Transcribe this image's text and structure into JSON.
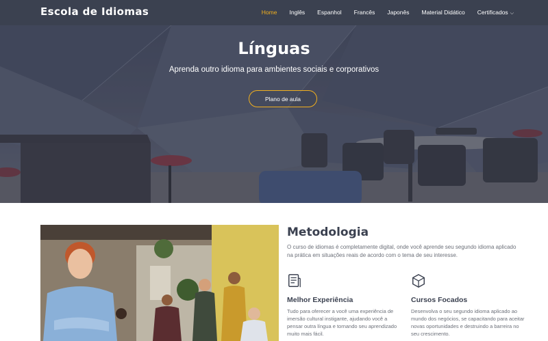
{
  "brand": "Escola de Idiomas",
  "nav": {
    "items": [
      "Home",
      "Inglês",
      "Espanhol",
      "Francês",
      "Japonês",
      "Material Didático",
      "Certificados"
    ],
    "active_index": 0
  },
  "hero": {
    "title": "Línguas",
    "subtitle": "Aprenda outro idioma para ambientes sociais e corporativos",
    "button": "Plano de aula"
  },
  "methodology": {
    "title": "Metodologia",
    "text": "O curso de idiomas é completamente digital, onde você aprende seu segundo idioma aplicado na prática em situações reais de acordo com o tema de seu interesse.",
    "features": [
      {
        "icon": "document-icon",
        "title": "Melhor Experiência",
        "text": "Tudo para oferecer a você uma experiência de imersão cultural instigante, ajudando você a pensar outra língua e tornando seu aprendizado muito mais fácil."
      },
      {
        "icon": "cube-icon",
        "title": "Cursos Focados",
        "text": "Desenvolva o seu segundo idioma aplicado ao mundo dos negócios, se capacitando para aceitar novas oportunidades e destruindo a barreira no seu crescimento."
      }
    ]
  },
  "colors": {
    "navbar": "#3b4150",
    "accent": "#f2b01e",
    "heading": "#3b4150",
    "body_text": "#6b6f78"
  }
}
